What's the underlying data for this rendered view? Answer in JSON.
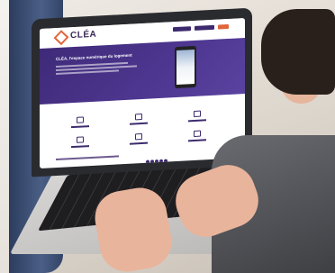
{
  "brand": {
    "name": "CLÉA",
    "accent": "#e1653b",
    "primary": "#3e2a78"
  },
  "hero": {
    "title": "CLÉA, l'espace numérique du logement"
  }
}
